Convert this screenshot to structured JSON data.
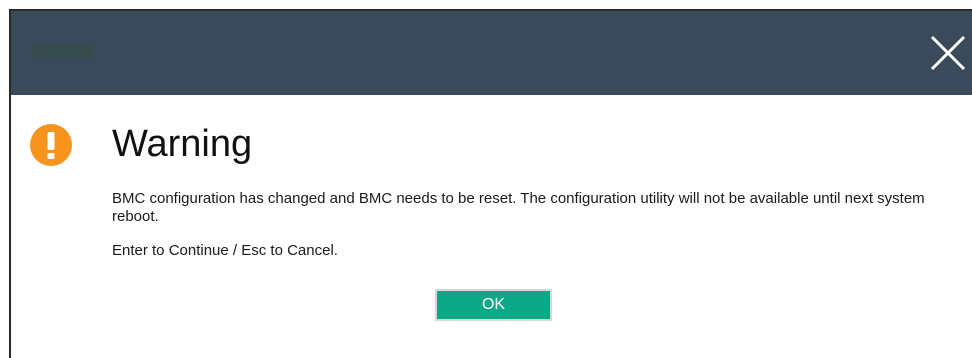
{
  "dialog": {
    "close_icon": "close-icon",
    "warning_icon": "warning-exclamation-icon",
    "title": "Warning",
    "message": "BMC configuration has changed and BMC needs to be reset. The configuration utility will not be available until next system reboot.",
    "instruction": "Enter to Continue / Esc to Cancel.",
    "ok_label": "OK"
  },
  "colors": {
    "titlebar": "#3a4a5a",
    "warning": "#f7941d",
    "ok_button": "#0aa886"
  }
}
